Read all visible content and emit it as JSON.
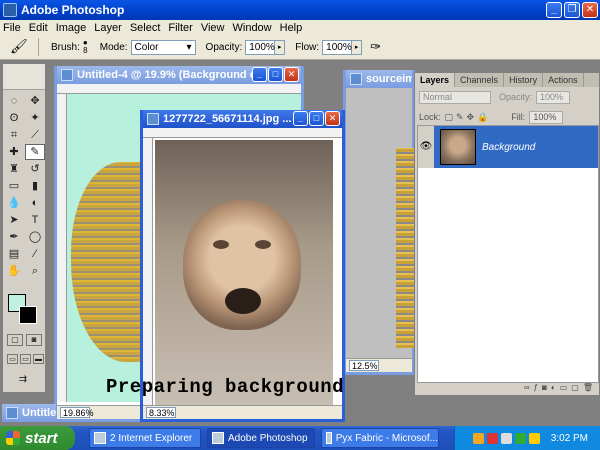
{
  "app": {
    "title": "Adobe Photoshop"
  },
  "menu": [
    "File",
    "Edit",
    "Image",
    "Layer",
    "Select",
    "Filter",
    "View",
    "Window",
    "Help"
  ],
  "options": {
    "brush_label": "Brush:",
    "brush_size": "8",
    "mode_label": "Mode:",
    "mode_value": "Color",
    "opacity_label": "Opacity:",
    "opacity_value": "100%",
    "flow_label": "Flow:",
    "flow_value": "100%"
  },
  "windows": {
    "untitled": {
      "title": "Untitled-4 @ 19.9% (Background c...",
      "zoom": "19.86%"
    },
    "jpg": {
      "title": "1277722_56671114.jpg ...",
      "zoom": "8.33%"
    },
    "source": {
      "title": "sourceimag",
      "zoom": "12.5%"
    },
    "minimized": {
      "title": "Untitle..."
    }
  },
  "layers_panel": {
    "tabs": [
      "Layers",
      "Channels",
      "History",
      "Actions"
    ],
    "blend_mode": "Normal",
    "opacity_label": "Opacity:",
    "opacity_value": "100%",
    "lock_label": "Lock:",
    "fill_label": "Fill:",
    "fill_value": "100%",
    "layer_name": "Background"
  },
  "caption": "Preparing background",
  "taskbar": {
    "start": "start",
    "tasks": [
      "2 Internet Explorer",
      "Adobe Photoshop",
      "Pyx Fabric - Microsof..."
    ],
    "clock": "3:02 PM"
  },
  "colors": {
    "foreground": "#bff0e0",
    "background": "#000000",
    "xp_blue": "#2a5fd8",
    "selection": "#316ac5"
  }
}
